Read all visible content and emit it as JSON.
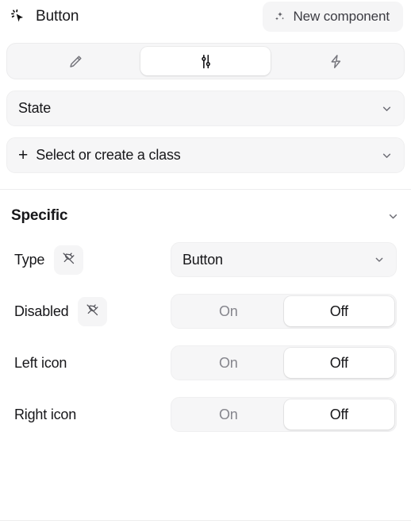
{
  "header": {
    "icon": "cursor-click-icon",
    "title": "Button",
    "new_component": {
      "icon": "sparkles-icon",
      "label": "New component"
    }
  },
  "tabs": [
    {
      "name": "tab-style",
      "icon": "pencil-icon",
      "selected": false
    },
    {
      "name": "tab-settings",
      "icon": "sliders-icon",
      "selected": true
    },
    {
      "name": "tab-actions",
      "icon": "lightning-icon",
      "selected": false
    }
  ],
  "selectors": {
    "state": {
      "label": "State",
      "chevron": "chevron-down-icon"
    },
    "class": {
      "plus": "+",
      "label": "Select or create a class",
      "chevron": "chevron-down-icon"
    }
  },
  "section": {
    "title": "Specific",
    "chevron": "chevron-down-icon"
  },
  "properties": [
    {
      "name": "type",
      "label": "Type",
      "bind_icon": "plug-icon",
      "has_bind": true,
      "control": "select",
      "value": "Button",
      "chevron": "chevron-down-icon"
    },
    {
      "name": "disabled",
      "label": "Disabled",
      "bind_icon": "plug-icon",
      "has_bind": true,
      "control": "segmented",
      "options": [
        "On",
        "Off"
      ],
      "selected": "Off"
    },
    {
      "name": "left-icon",
      "label": "Left icon",
      "has_bind": false,
      "control": "segmented",
      "options": [
        "On",
        "Off"
      ],
      "selected": "Off"
    },
    {
      "name": "right-icon",
      "label": "Right icon",
      "has_bind": false,
      "control": "segmented",
      "options": [
        "On",
        "Off"
      ],
      "selected": "Off"
    }
  ],
  "colors": {
    "background": "#ffffff",
    "field_fill": "#f6f6f7",
    "field_border": "#efeff0",
    "text_primary": "#17171a",
    "text_muted": "#86868d",
    "divider": "#ededee"
  }
}
